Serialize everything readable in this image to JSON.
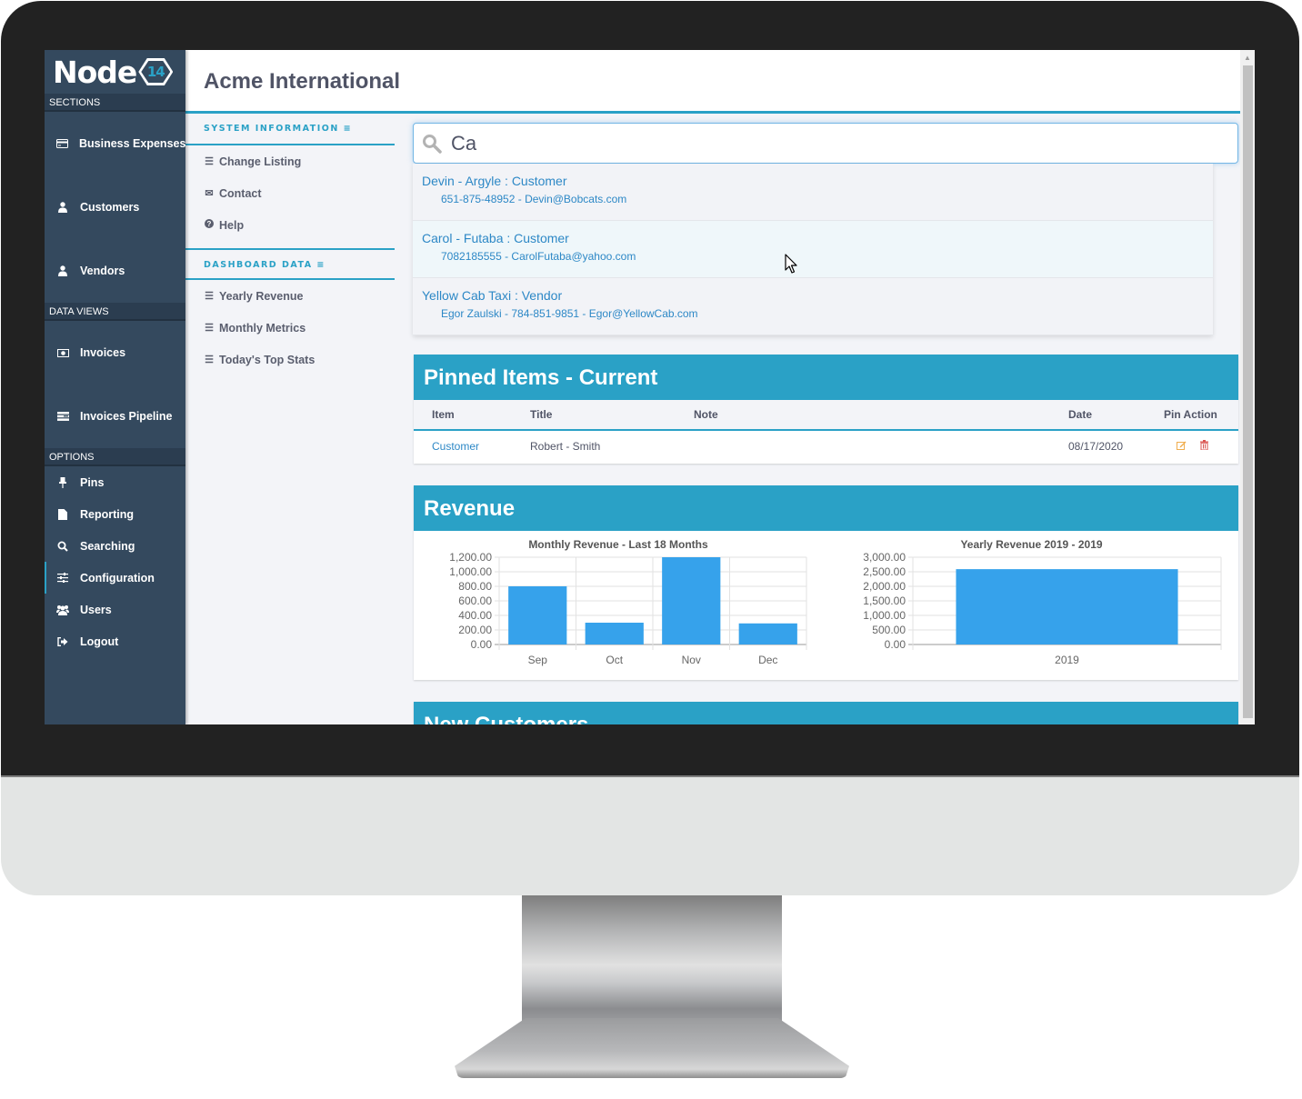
{
  "app": {
    "logo_text": "Node",
    "logo_badge": "14",
    "company_title": "Acme International"
  },
  "sidebar": {
    "sections": [
      {
        "header": "SECTIONS",
        "items": [
          {
            "label": "Business Expenses",
            "icon": "credit-card-icon"
          },
          {
            "label": "Customers",
            "icon": "user-icon"
          },
          {
            "label": "Vendors",
            "icon": "user-icon"
          }
        ]
      },
      {
        "header": "DATA VIEWS",
        "items": [
          {
            "label": "Invoices",
            "icon": "money-icon"
          },
          {
            "label": "Invoices Pipeline",
            "icon": "pipeline-icon"
          }
        ]
      },
      {
        "header": "OPTIONS",
        "items": [
          {
            "label": "Pins",
            "icon": "pin-icon"
          },
          {
            "label": "Reporting",
            "icon": "file-icon"
          },
          {
            "label": "Searching",
            "icon": "search-icon"
          },
          {
            "label": "Configuration",
            "icon": "sliders-icon",
            "active": true
          },
          {
            "label": "Users",
            "icon": "users-icon"
          },
          {
            "label": "Logout",
            "icon": "logout-icon"
          }
        ]
      }
    ]
  },
  "submenu": {
    "system_header": "SYSTEM INFORMATION",
    "system_items": [
      {
        "label": "Change Listing",
        "icon": "list-icon"
      },
      {
        "label": "Contact",
        "icon": "envelope-icon"
      },
      {
        "label": "Help",
        "icon": "question-circle-icon"
      }
    ],
    "dashboard_header": "DASHBOARD DATA",
    "dashboard_items": [
      {
        "label": "Yearly Revenue",
        "icon": "list-icon"
      },
      {
        "label": "Monthly Metrics",
        "icon": "list-icon"
      },
      {
        "label": "Today's Top Stats",
        "icon": "list-icon"
      }
    ]
  },
  "search": {
    "value": "Ca",
    "results": [
      {
        "title": "Devin - Argyle : Customer",
        "detail": "651-875-48952 - Devin@Bobcats.com"
      },
      {
        "title": "Carol - Futaba : Customer",
        "detail": "7082185555 - CarolFutaba@yahoo.com",
        "hovered": true
      },
      {
        "title": "Yellow Cab Taxi : Vendor",
        "detail": "Egor Zaulski - 784-851-9851 - Egor@YellowCab.com"
      }
    ]
  },
  "pinned": {
    "title": "Pinned Items - Current",
    "columns": [
      "Item",
      "Title",
      "Note",
      "Date",
      "Pin Action"
    ],
    "rows": [
      {
        "item": "Customer",
        "title": "Robert - Smith",
        "note": "",
        "date": "08/17/2020"
      }
    ]
  },
  "revenue": {
    "title": "Revenue"
  },
  "new_customers": {
    "title": "New Customers"
  },
  "colors": {
    "accent": "#2aa1c6",
    "sidebar": "#34495e",
    "bar": "#36a2eb",
    "link": "#2d88c6",
    "edit_icon": "#f0ad4e",
    "delete_icon": "#d9534f"
  },
  "chart_data": [
    {
      "type": "bar",
      "title": "Monthly Revenue - Last 18 Months",
      "categories": [
        "Sep",
        "Oct",
        "Nov",
        "Dec"
      ],
      "values": [
        800,
        300,
        1200,
        290
      ],
      "xlabel": "",
      "ylabel": "",
      "ylim": [
        0,
        1200
      ],
      "yticks": [
        0,
        200,
        400,
        600,
        800,
        1000,
        1200
      ],
      "ytick_labels": [
        "0.00",
        "200.00",
        "400.00",
        "600.00",
        "800.00",
        "1,000.00",
        "1,200.00"
      ],
      "grid": true,
      "legend": "none"
    },
    {
      "type": "bar",
      "title": "Yearly Revenue 2019 - 2019",
      "categories": [
        "2019"
      ],
      "values": [
        2590
      ],
      "xlabel": "",
      "ylabel": "",
      "ylim": [
        0,
        3000
      ],
      "yticks": [
        0,
        500,
        1000,
        1500,
        2000,
        2500,
        3000
      ],
      "ytick_labels": [
        "0.00",
        "500.00",
        "1,000.00",
        "1,500.00",
        "2,000.00",
        "2,500.00",
        "3,000.00"
      ],
      "grid": true,
      "legend": "none"
    }
  ]
}
